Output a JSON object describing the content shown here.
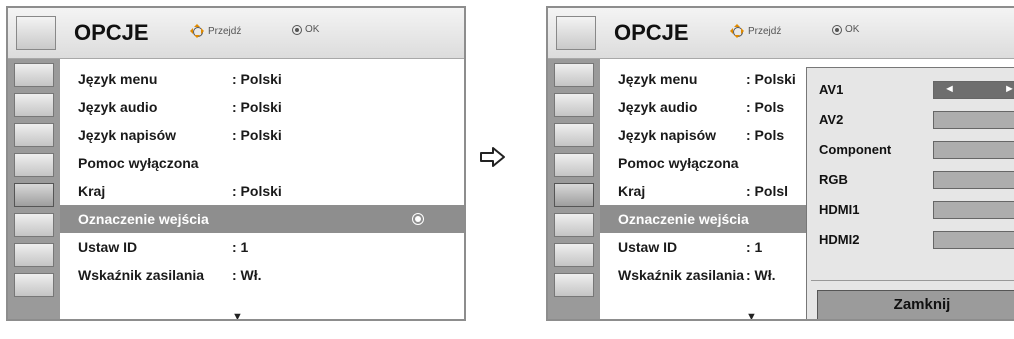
{
  "header": {
    "title": "OPCJE",
    "nav_hint": "Przejdź",
    "ok_hint": "OK"
  },
  "menu": {
    "items": [
      {
        "label": "Język menu",
        "value": ": Polski"
      },
      {
        "label": "Język audio",
        "value": ": Polski"
      },
      {
        "label": "Język napisów",
        "value": ": Polski"
      },
      {
        "label": "Pomoc wyłączona",
        "value": ""
      },
      {
        "label": "Kraj",
        "value": ": Polski"
      },
      {
        "label": "Oznaczenie wejścia",
        "value": ""
      },
      {
        "label": "Ustaw ID",
        "value": ": 1"
      },
      {
        "label": "Wskaźnik zasilania",
        "value": ": Wł."
      }
    ],
    "selected_index": 5,
    "more_indicator": "▼"
  },
  "right_menu": {
    "values": [
      ": Polski",
      ": Pols",
      ": Pols",
      "",
      ": Polsl",
      "",
      ": 1",
      ": Wł."
    ]
  },
  "popup": {
    "items": [
      "AV1",
      "AV2",
      "Component",
      "RGB",
      "HDMI1",
      "HDMI2"
    ],
    "active_index": 0,
    "left_arrow": "◄",
    "right_arrow": "►",
    "close_label": "Zamknij"
  },
  "sidebar_icons": [
    "picture-icon",
    "screen-icon",
    "audio-icon",
    "time-icon",
    "option-icon",
    "lock-icon",
    "input-icon",
    "media-icon"
  ],
  "colors": {
    "highlight": "#8e8e8e",
    "sidebar": "#9a9a9a",
    "accent": "#e08a00"
  }
}
